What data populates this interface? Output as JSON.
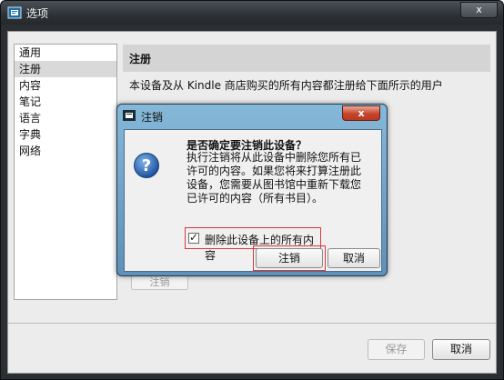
{
  "window": {
    "title": "选项",
    "close_label": "x"
  },
  "sidebar": {
    "items": [
      {
        "label": "通用",
        "selected": false
      },
      {
        "label": "注册",
        "selected": true
      },
      {
        "label": "内容",
        "selected": false
      },
      {
        "label": "笔记",
        "selected": false
      },
      {
        "label": "语言",
        "selected": false
      },
      {
        "label": "字典",
        "selected": false
      },
      {
        "label": "网络",
        "selected": false
      }
    ]
  },
  "panel": {
    "header": "注册",
    "description": "本设备及从 Kindle 商店购买的所有内容都注册给下面所示的用户",
    "background_deregister_label": "注销"
  },
  "footer": {
    "save_label": "保存",
    "cancel_label": "取消"
  },
  "dialog": {
    "title": "注销",
    "close_label": "x",
    "heading": "是否确定要注销此设备？",
    "message": "执行注销将从此设备中删除您所有已许可的内容。如果您将来打算注册此设备，您需要从图书馆中重新下载您已许可的内容（所有书目）。",
    "checkbox_label": "删除此设备上的所有内容",
    "checkbox_checked": true,
    "deregister_label": "注销",
    "cancel_label": "取消"
  },
  "colors": {
    "highlight": "#d8373e",
    "dialog_title_gradient": "#85b8d8",
    "window_frame": "#2b2f33"
  }
}
